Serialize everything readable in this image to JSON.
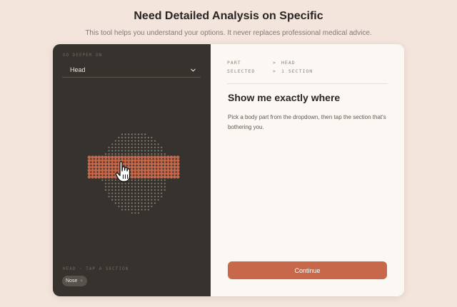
{
  "header": {
    "title": "Need Detailed Analysis on Specific",
    "subtitle": "This tool helps you understand your options. It never replaces professional medical advice."
  },
  "left_panel": {
    "select_label": "GO DEEPER ON",
    "select_value": "Head",
    "section_hint": "HEAD · TAP A SECTION",
    "chips": [
      {
        "label": "Nose",
        "remove": "×"
      }
    ]
  },
  "right_panel": {
    "meta": [
      {
        "key": "PART",
        "sep": ">",
        "value": "HEAD"
      },
      {
        "key": "SELECTED",
        "sep": ">",
        "value": "1 SECTION"
      }
    ],
    "title": "Show me exactly where",
    "description": "Pick a body part from the dropdown, then tap the section that's bothering you.",
    "continue_label": "Continue"
  },
  "colors": {
    "accent": "#c8684b",
    "dark_panel": "#36332e",
    "light_panel": "#fbf8f4",
    "background": "#f3e5dc",
    "dot_idle": "#86817a"
  },
  "icons": {
    "dropdown": "chevron-down-icon",
    "pointer": "hand-pointer-icon",
    "chip_remove": "close-icon"
  }
}
